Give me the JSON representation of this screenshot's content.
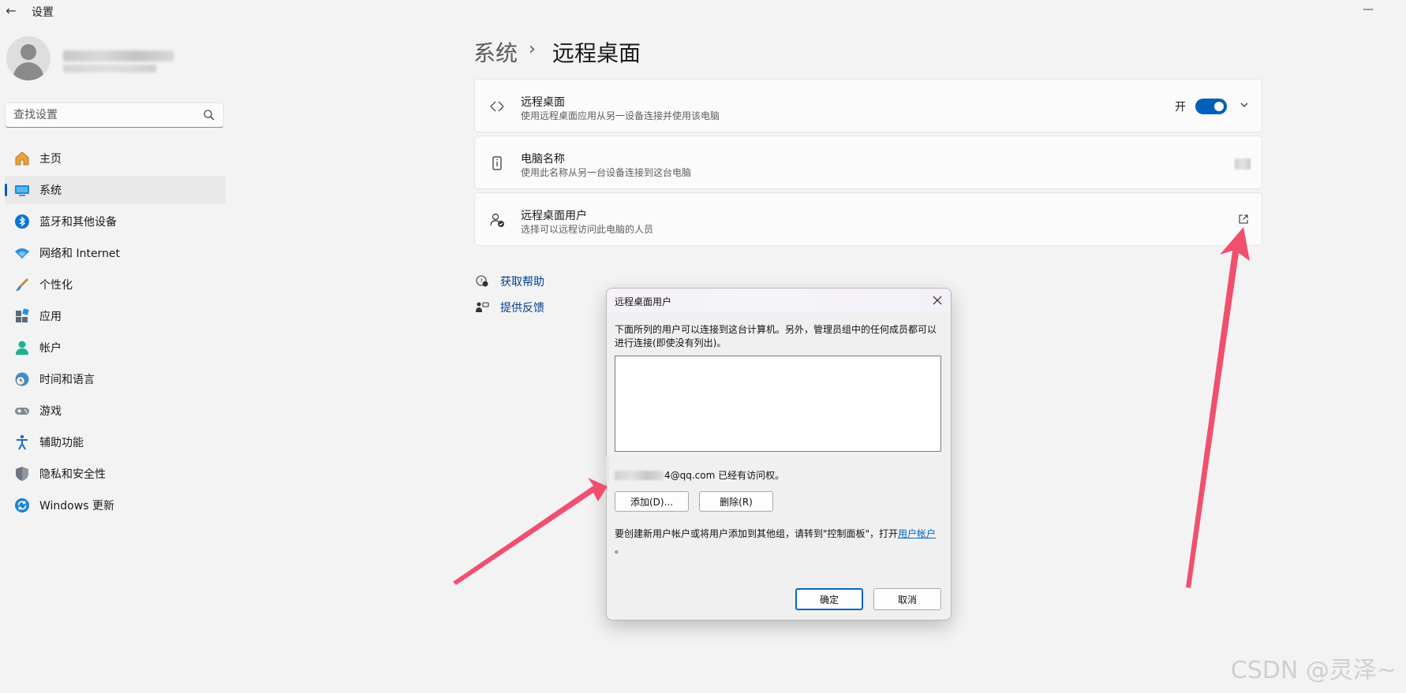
{
  "window": {
    "title": "设置",
    "back_icon": "back-arrow-icon",
    "minimize_icon": "minimize-icon"
  },
  "search": {
    "placeholder": "查找设置",
    "icon": "search-icon"
  },
  "sidebar": {
    "items": [
      {
        "label": "主页",
        "icon": "home-icon"
      },
      {
        "label": "系统",
        "icon": "system-display-icon",
        "active": true
      },
      {
        "label": "蓝牙和其他设备",
        "icon": "bluetooth-icon"
      },
      {
        "label": "网络和 Internet",
        "icon": "wifi-icon"
      },
      {
        "label": "个性化",
        "icon": "brush-icon"
      },
      {
        "label": "应用",
        "icon": "apps-icon"
      },
      {
        "label": "帐户",
        "icon": "account-icon"
      },
      {
        "label": "时间和语言",
        "icon": "time-language-icon"
      },
      {
        "label": "游戏",
        "icon": "gamepad-icon"
      },
      {
        "label": "辅助功能",
        "icon": "accessibility-icon"
      },
      {
        "label": "隐私和安全性",
        "icon": "shield-icon"
      },
      {
        "label": "Windows 更新",
        "icon": "update-icon"
      }
    ]
  },
  "breadcrumb": {
    "parent": "系统",
    "separator": "›",
    "current": "远程桌面"
  },
  "cards": {
    "remote_desktop": {
      "title": "远程桌面",
      "subtitle": "使用远程桌面应用从另一设备连接并使用该电脑",
      "toggle_label": "开",
      "toggle_on": true
    },
    "pc_name": {
      "title": "电脑名称",
      "subtitle": "使用此名称从另一台设备连接到这台电脑"
    },
    "rd_users": {
      "title": "远程桌面用户",
      "subtitle": "选择可以远程访问此电脑的人员"
    }
  },
  "help_links": {
    "get_help": "获取帮助",
    "feedback": "提供反馈"
  },
  "dialog": {
    "title": "远程桌面用户",
    "description": "下面所列的用户可以连接到这台计算机。另外，管理员组中的任何成员都可以进行连接(即使没有列出)。",
    "access_suffix": "4@qq.com 已经有访问权。",
    "add_button": "添加(D)...",
    "remove_button": "删除(R)",
    "note_prefix": "要创建新用户帐户或将用户添加到其他组，请转到\"控制面板\"，打开",
    "note_link": "用户帐户",
    "note_suffix": "。",
    "ok_button": "确定",
    "cancel_button": "取消"
  },
  "watermark": "CSDN @灵泽~",
  "colors": {
    "accent": "#005fb8",
    "annotation_arrow": "#f0506e",
    "link": "#003e92"
  }
}
